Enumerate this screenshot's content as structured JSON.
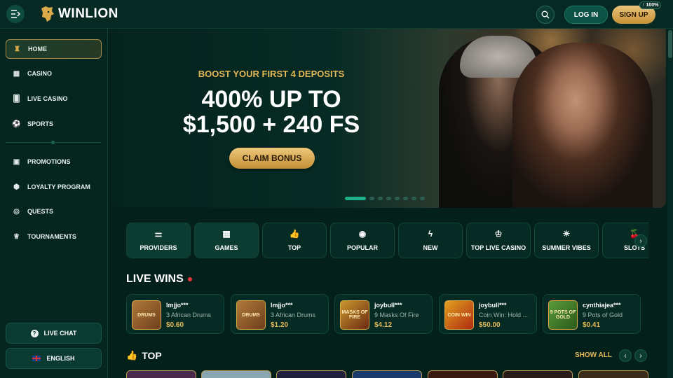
{
  "header": {
    "logo_text": "WINLION",
    "login_label": "LOG IN",
    "signup_label": "SIGN UP",
    "badge": "100%"
  },
  "sidebar": {
    "items": [
      {
        "label": "HOME",
        "icon": "castle-icon",
        "active": true
      },
      {
        "label": "CASINO",
        "icon": "grid-icon"
      },
      {
        "label": "LIVE CASINO",
        "icon": "cards-icon"
      },
      {
        "label": "SPORTS",
        "icon": "ball-icon"
      },
      {
        "label": "PROMOTIONS",
        "icon": "gift-icon"
      },
      {
        "label": "LOYALTY PROGRAM",
        "icon": "hexagon-icon"
      },
      {
        "label": "QUESTS",
        "icon": "target-icon"
      },
      {
        "label": "TOURNAMENTS",
        "icon": "trophy-icon"
      }
    ],
    "live_chat": "LIVE CHAT",
    "language": "ENGLISH"
  },
  "hero": {
    "subtitle": "BOOST YOUR FIRST 4 DEPOSITS",
    "title_line1": "400% UP TO",
    "title_line2": "$1,500 + 240 FS",
    "cta": "CLAIM BONUS",
    "slides": 8,
    "active_slide": 1
  },
  "categories": [
    {
      "label": "PROVIDERS",
      "icon": "sliders-icon"
    },
    {
      "label": "GAMES",
      "icon": "grid-icon"
    },
    {
      "label": "TOP",
      "icon": "thumbs-up-icon"
    },
    {
      "label": "POPULAR",
      "icon": "chip-icon"
    },
    {
      "label": "NEW",
      "icon": "lightning-icon"
    },
    {
      "label": "TOP LIVE CASINO",
      "icon": "crown-icon"
    },
    {
      "label": "SUMMER VIBES",
      "icon": "palm-icon"
    },
    {
      "label": "SLOTS",
      "icon": "cherry-icon"
    }
  ],
  "live_wins": {
    "title": "LIVE WINS",
    "items": [
      {
        "user": "lmjjo***",
        "game": "3 African Drums",
        "amount": "$0.60",
        "thumb": "DRUMS"
      },
      {
        "user": "lmjjo***",
        "game": "3 African Drums",
        "amount": "$1.20",
        "thumb": "DRUMS"
      },
      {
        "user": "joybull***",
        "game": "9 Masks Of Fire",
        "amount": "$4.12",
        "thumb": "MASKS OF FIRE"
      },
      {
        "user": "joybull***",
        "game": "Coin Win: Hold ...",
        "amount": "$50.00",
        "thumb": "COIN WIN"
      },
      {
        "user": "cynthiajea***",
        "game": "9 Pots of Gold",
        "amount": "$0.41",
        "thumb": "9 POTS OF GOLD"
      }
    ]
  },
  "top": {
    "title": "TOP",
    "show_all": "SHOW ALL"
  }
}
